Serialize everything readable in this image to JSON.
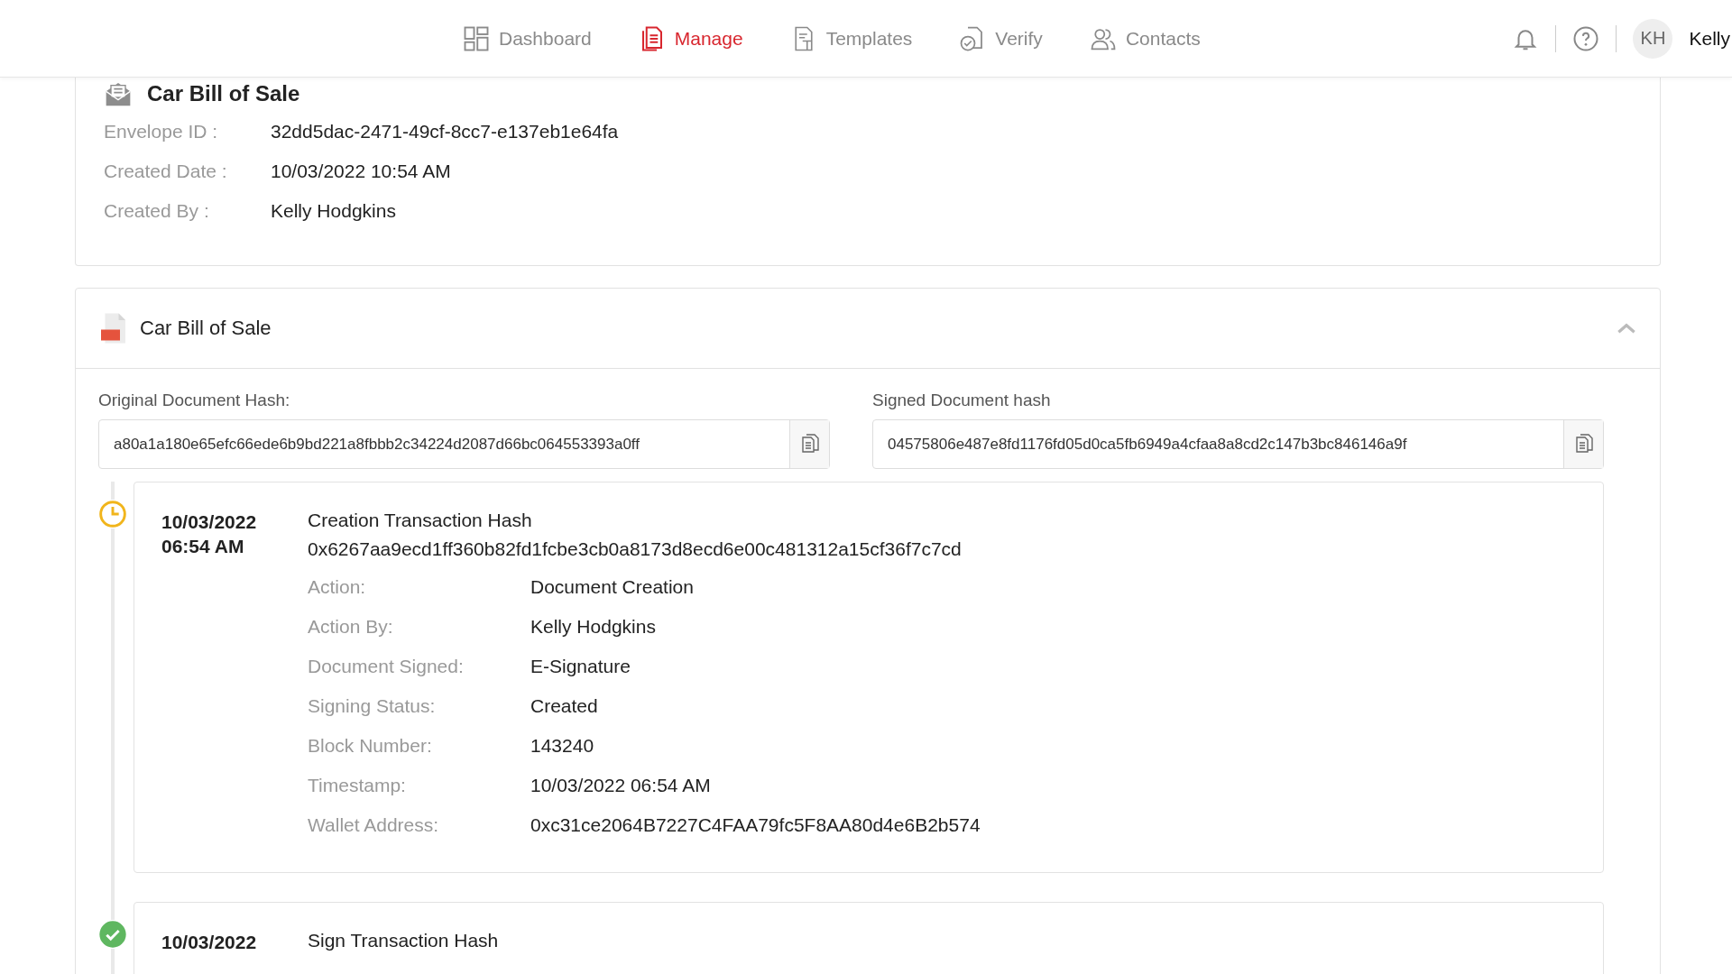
{
  "nav": {
    "tabs": [
      {
        "label": "Dashboard",
        "selected": false
      },
      {
        "label": "Manage",
        "selected": true
      },
      {
        "label": "Templates",
        "selected": false
      },
      {
        "label": "Verify",
        "selected": false
      },
      {
        "label": "Contacts",
        "selected": false
      }
    ],
    "user": {
      "initials": "KH",
      "name": "Kelly"
    }
  },
  "envelope": {
    "title": "Car Bill of Sale",
    "fields": [
      {
        "label": "Envelope ID :",
        "value": "32dd5dac-2471-49cf-8cc7-e137eb1e64fa"
      },
      {
        "label": "Created Date :",
        "value": "10/03/2022 10:54 AM"
      },
      {
        "label": "Created By :",
        "value": "Kelly Hodgkins"
      }
    ]
  },
  "document": {
    "title": "Car Bill of Sale",
    "expanded": true,
    "hashes": [
      {
        "label": "Original Document Hash:",
        "value": "a80a1a180e65efc66ede6b9bd221a8fbbb2c34224d2087d66bc064553393a0ff"
      },
      {
        "label": "Signed Document hash",
        "value": "04575806e487e8fd1176fd05d0ca5fb6949a4cfaa8a8cd2c147b3bc846146a9f"
      }
    ],
    "timeline": [
      {
        "kind": "pending",
        "date": "10/03/2022",
        "time": "06:54 AM",
        "title": "Creation Transaction Hash",
        "hash": "0x6267aa9ecd1ff360b82fd1fcbe3cb0a8173d8ecd6e00c481312a15cf36f7c7cd",
        "details": [
          {
            "label": "Action:",
            "value": "Document Creation"
          },
          {
            "label": "Action By:",
            "value": "Kelly Hodgkins"
          },
          {
            "label": "Document Signed:",
            "value": "E-Signature"
          },
          {
            "label": "Signing Status:",
            "value": "Created"
          },
          {
            "label": "Block Number:",
            "value": "143240"
          },
          {
            "label": "Timestamp:",
            "value": "10/03/2022 06:54 AM"
          },
          {
            "label": "Wallet Address:",
            "value": "0xc31ce2064B7227C4FAA79fc5F8AA80d4e6B2b574"
          }
        ]
      },
      {
        "kind": "done",
        "date": "10/03/2022",
        "title": "Sign Transaction Hash"
      }
    ]
  }
}
